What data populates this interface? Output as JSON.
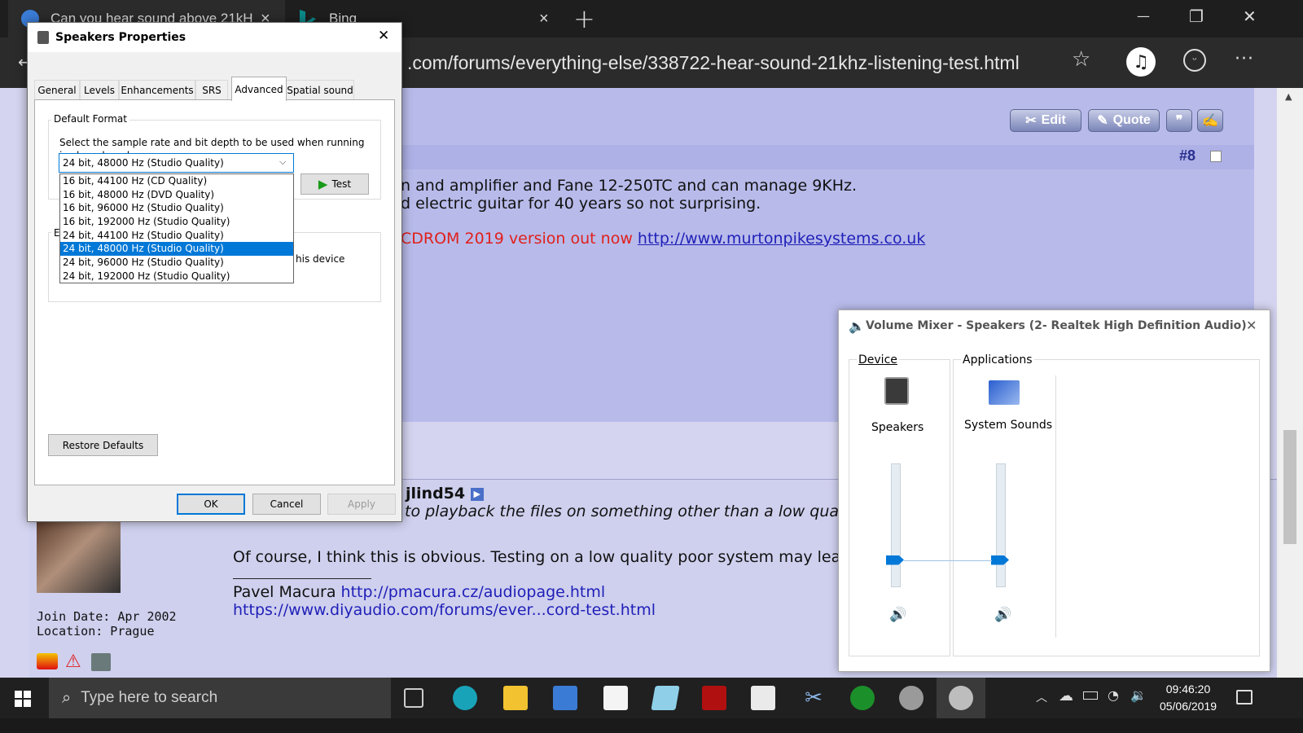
{
  "browser": {
    "tabs": [
      {
        "title": "Can you hear sound above 21kH",
        "close": "×"
      },
      {
        "title": "Bing",
        "close": "×"
      }
    ],
    "new_tab": "+",
    "url": ".com/forums/everything-else/338722-hear-sound-21khz-listening-test.html",
    "window_controls": {
      "minimize": "—",
      "maximize": "❐",
      "close": "✕"
    },
    "toolbar": {
      "star": "☆",
      "more": "···"
    }
  },
  "post": {
    "edit_label": "Edit",
    "quote_label": "Quote",
    "number": "#8",
    "line1": "n and amplifier and Fane 12-250TC and can manage 9KHz.",
    "line2": "d electric guitar for 40 years so not surprising.",
    "sig_text": "CDROM 2019 version out now",
    "sig_link": "http://www.murtonpikesystems.co.uk"
  },
  "reply": {
    "quoted_user": "jlind54",
    "quote_text": "to playback the files on something other than a low quality so",
    "body": "Of course, I think this is obvious. Testing on a low quality poor system may lead to fa",
    "sig_name": "Pavel Macura",
    "sig_link1": "http://pmacura.cz/audiopage.html",
    "sig_link2": "https://www.diyaudio.com/forums/ever...cord-test.html",
    "join_date": "Join Date: Apr 2002",
    "location": "Location: Prague"
  },
  "speakers_dialog": {
    "title": "Speakers Properties",
    "close": "✕",
    "tabs": [
      "General",
      "Levels",
      "Enhancements",
      "SRS",
      "Advanced",
      "Spatial sound"
    ],
    "selected_tab": "Advanced",
    "default_format_label": "Default Format",
    "description": "Select the sample rate and bit depth to be used when running in shared mode.",
    "selected_format": "24 bit, 48000 Hz (Studio Quality)",
    "test_label": "Test",
    "formats": [
      "16 bit, 44100 Hz (CD Quality)",
      "16 bit, 48000 Hz (DVD Quality)",
      "16 bit, 96000 Hz (Studio Quality)",
      "16 bit, 192000 Hz (Studio Quality)",
      "24 bit, 44100 Hz (Studio Quality)",
      "24 bit, 48000 Hz (Studio Quality)",
      "24 bit, 96000 Hz (Studio Quality)",
      "24 bit, 192000 Hz (Studio Quality)"
    ],
    "selected_index": 5,
    "exclusive_fragment": "his device",
    "group2_fragment": "E",
    "restore_defaults": "Restore Defaults",
    "ok": "OK",
    "cancel": "Cancel",
    "apply": "Apply"
  },
  "volume_mixer": {
    "title": "Volume Mixer - Speakers (2- Realtek High Definition Audio)",
    "close": "✕",
    "device_label": "Device",
    "applications_label": "Applications",
    "device_name": "Speakers",
    "app_name": "System Sounds",
    "speakers_level": 0.22,
    "system_sounds_level": 0.22
  },
  "taskbar": {
    "search_placeholder": "Type here to search",
    "time": "09:46:20",
    "date": "05/06/2019"
  },
  "colors": {
    "accent": "#0078d7",
    "link": "#1f1fb8",
    "signature_red": "#e0201c"
  }
}
